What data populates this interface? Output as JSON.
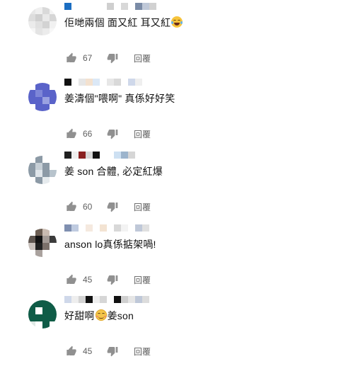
{
  "reply_label": "回覆",
  "comments": [
    {
      "text_before": "佢哋兩個 面又紅 耳又紅",
      "emoji": "laughing-tears",
      "text_after": "",
      "likes": "67",
      "avatar": [
        "#e7e7e7",
        "#efefef",
        "#d9d9d9",
        "#f3f3f3",
        "#dddddd",
        "#cfcfcf",
        "#e9e9e9",
        "#d6d6d6",
        "#ebebeb",
        "#e0e0e0",
        "#d3d3d3",
        "#f1f1f1",
        "#f6f6f6",
        "#e4e4e4",
        "#ececec",
        "#f7f7f7"
      ],
      "name_blocks": [
        "#1b6ec2",
        "",
        "",
        "",
        "",
        "",
        "#cfcfcf",
        "",
        "#d8d8d8",
        "",
        "#7a8ba6",
        "#bfc8d8",
        "#d1d1d1"
      ]
    },
    {
      "text_before": "姜濤個\"喂啊\" 真係好好笑",
      "emoji": "",
      "text_after": "",
      "likes": "66",
      "avatar": [
        "#ffffff",
        "#5a63c9",
        "#5a63c9",
        "#ffffff",
        "#5a63c9",
        "#7e86d8",
        "#5a63c9",
        "#5a63c9",
        "#5a63c9",
        "#5a63c9",
        "#9aa1e1",
        "#5a63c9",
        "#ffffff",
        "#5a63c9",
        "#5a63c9",
        "#ffffff"
      ],
      "name_blocks": [
        "#111111",
        "",
        "#e6e6e6",
        "#f3e1cf",
        "#dbe8f6",
        "",
        "#e7e7e7",
        "#d9d9d9",
        "#ffffff",
        "#cfd8ea",
        "#efefef"
      ]
    },
    {
      "text_before": "姜 son 合體, 必定紅爆",
      "emoji": "",
      "text_after": "",
      "likes": "60",
      "avatar": [
        "#ffffff",
        "#8c9aa6",
        "#ffffff",
        "#ffffff",
        "#8c9aa6",
        "#c6cfd6",
        "#8c9aa6",
        "#ffffff",
        "#8c9aa6",
        "#dfe5ea",
        "#8c9aa6",
        "#b7c3cc",
        "#ffffff",
        "#8c9aa6",
        "#e6ebee",
        "#ffffff"
      ],
      "name_blocks": [
        "#202020",
        "#efefef",
        "#8a2121",
        "#d8d8d8",
        "#111111",
        "",
        "",
        "#cde0f2",
        "#9cb4cc",
        "#d6d6d6"
      ]
    },
    {
      "text_before": "anson lo真係掂架喎!",
      "emoji": "",
      "text_after": "",
      "likes": "45",
      "avatar": [
        "#ffffff",
        "#6b5d52",
        "#c9bbb1",
        "#ffffff",
        "#5f5650",
        "#111111",
        "#a39a95",
        "#3b3b3b",
        "#c8c0bb",
        "#202020",
        "#7b706a",
        "#ffffff",
        "#ffffff",
        "#aaa29e",
        "#ffffff",
        "#ffffff"
      ],
      "name_blocks": [
        "#7f8fb0",
        "#bfcbe0",
        "",
        "#f5e9df",
        "",
        "#f3e3d2",
        "",
        "#d8d8d8",
        "#f3f3f3",
        "",
        "#bfc8d8",
        "#e0e0e0"
      ]
    },
    {
      "text_before": "好甜啊",
      "emoji": "smiling-face",
      "text_after": "姜son",
      "likes": "45",
      "avatar": [
        "#0f5c47",
        "#0f5c47",
        "#0f5c47",
        "#0f5c47",
        "#0f5c47",
        "#ffffff",
        "#0f5c47",
        "#0f5c47",
        "#0f5c47",
        "#0f5c47",
        "#0f5c47",
        "#0f5c47",
        "#dfe9e5",
        "#ffffff",
        "#0f5c47",
        "#ffffff"
      ],
      "name_blocks": [
        "#cfd8ea",
        "#eeeeee",
        "#d3d3d3",
        "#111111",
        "#efefef",
        "#d6d6d6",
        "",
        "#111111",
        "#cfcfcf",
        "#e6e6e6",
        "#bfc8d8",
        "#dcdcdc"
      ]
    }
  ]
}
